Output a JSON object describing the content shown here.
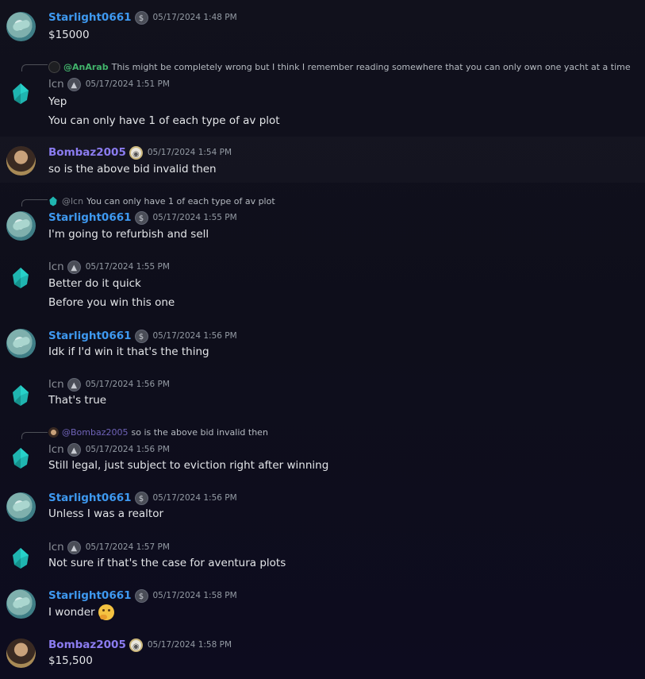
{
  "users": {
    "starlight": {
      "name": "Starlight0661",
      "badge": "$"
    },
    "lcn": {
      "name": "lcn",
      "badge": "▲"
    },
    "bombaz": {
      "name": "Bombaz2005",
      "badge": "◉"
    }
  },
  "messages": [
    {
      "author": "Starlight0661",
      "time": "05/17/2024 1:48 PM",
      "lines": [
        "$15000"
      ]
    },
    {
      "reply": {
        "mention": "@AnArab",
        "text": "This might be completely wrong but I think I remember reading somewhere that you can only own one yacht at a time"
      },
      "author": "lcn",
      "time": "05/17/2024 1:51 PM",
      "lines": [
        "Yep",
        "You can only have 1 of each type of av plot"
      ]
    },
    {
      "author": "Bombaz2005",
      "time": "05/17/2024 1:54 PM",
      "lines": [
        "so is the above bid invalid then"
      ]
    },
    {
      "reply": {
        "mention": "@lcn",
        "text": "You can only have 1 of each type of av plot"
      },
      "author": "Starlight0661",
      "time": "05/17/2024 1:55 PM",
      "lines": [
        "I'm going to refurbish and sell"
      ]
    },
    {
      "author": "lcn",
      "time": "05/17/2024 1:55 PM",
      "lines": [
        "Better do it quick",
        "Before you win this one"
      ]
    },
    {
      "author": "Starlight0661",
      "time": "05/17/2024 1:56 PM",
      "lines": [
        "Idk if I'd win it that's the thing"
      ]
    },
    {
      "author": "lcn",
      "time": "05/17/2024 1:56 PM",
      "lines": [
        "That's true"
      ]
    },
    {
      "reply": {
        "mention": "@Bombaz2005",
        "text": "so is the above bid invalid then"
      },
      "author": "lcn",
      "time": "05/17/2024 1:56 PM",
      "lines": [
        "Still legal, just subject to eviction right after winning"
      ]
    },
    {
      "author": "Starlight0661",
      "time": "05/17/2024 1:56 PM",
      "lines": [
        "Unless I was a realtor"
      ]
    },
    {
      "author": "lcn",
      "time": "05/17/2024 1:57 PM",
      "lines": [
        "Not sure if that's the case for aventura plots"
      ]
    },
    {
      "author": "Starlight0661",
      "time": "05/17/2024 1:58 PM",
      "lines": [
        "I wonder"
      ],
      "emoji": "thinking-face"
    },
    {
      "author": "Bombaz2005",
      "time": "05/17/2024 1:58 PM",
      "lines": [
        "$15,500"
      ]
    }
  ],
  "colors": {
    "starlight_name": "#3e99f0",
    "bombaz_name": "#8b7cf0",
    "lcn_name": "#8b8f97",
    "arab_mention": "#41b36b",
    "background": "#11111c"
  }
}
